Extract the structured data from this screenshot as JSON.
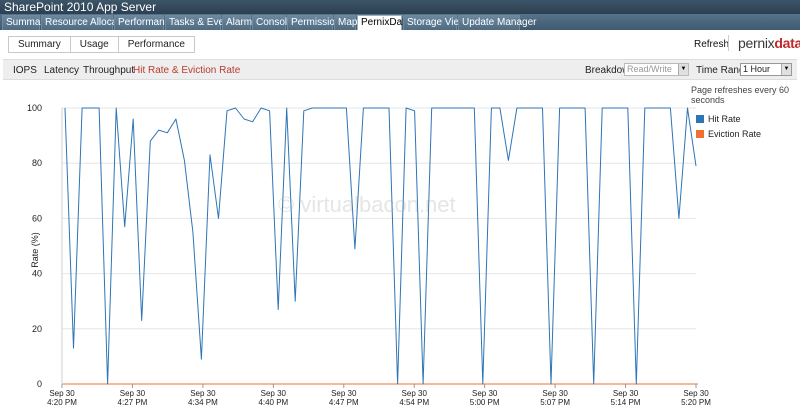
{
  "window": {
    "title": "SharePoint 2010 App Server"
  },
  "tabs": [
    {
      "label": "Summary"
    },
    {
      "label": "Resource Allocation"
    },
    {
      "label": "Performance"
    },
    {
      "label": "Tasks & Events"
    },
    {
      "label": "Alarms"
    },
    {
      "label": "Console"
    },
    {
      "label": "Permissions"
    },
    {
      "label": "Maps"
    },
    {
      "label": "PernixData"
    },
    {
      "label": "Storage Views"
    },
    {
      "label": "Update Manager"
    }
  ],
  "subtabs": [
    {
      "label": "Summary"
    },
    {
      "label": "Usage"
    },
    {
      "label": "Performance"
    }
  ],
  "header": {
    "refresh_label": "Refresh",
    "logo_part1": "pernix",
    "logo_part2": "data"
  },
  "metrics": [
    {
      "label": "IOPS"
    },
    {
      "label": "Latency"
    },
    {
      "label": "Throughput"
    },
    {
      "label": "Hit Rate & Eviction Rate"
    }
  ],
  "breakdown": {
    "label": "Breakdown:",
    "value": "Read/Write"
  },
  "time_range": {
    "label": "Time Range:",
    "value": "1 Hour"
  },
  "note": "Page refreshes every 60 seconds",
  "watermark": "© virtualbacon.net",
  "colors": {
    "hit": "#2e75b6",
    "eviction": "#f07030",
    "active_metric": "#b83a30"
  },
  "chart_data": {
    "type": "line",
    "ylabel": "Rate (%)",
    "ylim": [
      0,
      100
    ],
    "yticks": [
      0,
      20,
      40,
      60,
      80,
      100
    ],
    "x": [
      "4:20",
      "4:21",
      "4:22",
      "4:23",
      "4:24",
      "4:25",
      "4:26",
      "4:27",
      "4:28",
      "4:29",
      "4:30",
      "4:31",
      "4:32",
      "4:33",
      "4:34",
      "4:35",
      "4:36",
      "4:37",
      "4:38",
      "4:39",
      "4:40",
      "4:41",
      "4:42",
      "4:43",
      "4:44",
      "4:45",
      "4:46",
      "4:47",
      "4:48",
      "4:49",
      "4:50",
      "4:51",
      "4:52",
      "4:53",
      "4:54",
      "4:55",
      "4:56",
      "4:57",
      "4:58",
      "4:59",
      "5:00",
      "5:01",
      "5:02",
      "5:03",
      "5:04",
      "5:05",
      "5:06",
      "5:07",
      "5:08",
      "5:09",
      "5:10",
      "5:11",
      "5:12",
      "5:13",
      "5:14",
      "5:15",
      "5:16",
      "5:17",
      "5:18",
      "5:19",
      "5:20"
    ],
    "xticks": [
      {
        "date": "Sep 30",
        "time": "4:20 PM"
      },
      {
        "date": "Sep 30",
        "time": "4:27 PM"
      },
      {
        "date": "Sep 30",
        "time": "4:34 PM"
      },
      {
        "date": "Sep 30",
        "time": "4:40 PM"
      },
      {
        "date": "Sep 30",
        "time": "4:47 PM"
      },
      {
        "date": "Sep 30",
        "time": "4:54 PM"
      },
      {
        "date": "Sep 30",
        "time": "5:00 PM"
      },
      {
        "date": "Sep 30",
        "time": "5:07 PM"
      },
      {
        "date": "Sep 30",
        "time": "5:14 PM"
      },
      {
        "date": "Sep 30",
        "time": "5:20 PM"
      }
    ],
    "series": [
      {
        "name": "Hit Rate",
        "values": [
          100,
          13,
          100,
          100,
          100,
          0,
          100,
          57,
          96,
          23,
          88,
          92,
          91,
          96,
          81,
          55,
          9,
          83,
          60,
          99,
          100,
          96,
          95,
          100,
          99,
          27,
          100,
          30,
          99,
          100,
          100,
          100,
          100,
          100,
          49,
          100,
          100,
          100,
          100,
          0,
          100,
          99,
          0,
          100,
          100,
          100,
          100,
          100,
          100,
          0,
          100,
          100,
          81,
          100,
          100,
          100,
          100,
          0,
          100,
          100,
          100,
          100,
          0,
          100,
          100,
          100,
          100,
          0,
          100,
          100,
          100,
          100,
          60,
          100,
          79
        ]
      },
      {
        "name": "Eviction Rate",
        "values": [
          0,
          0,
          0,
          0,
          0,
          0,
          0,
          0,
          0,
          0,
          0,
          0,
          0,
          0,
          0,
          0,
          0,
          0,
          0,
          0,
          0,
          0,
          0,
          0,
          0,
          0,
          0,
          0,
          0,
          0,
          0,
          0,
          0,
          0,
          0,
          0,
          0,
          0,
          0,
          0,
          0,
          0,
          0,
          0,
          0,
          0,
          0,
          0,
          0,
          0,
          0,
          0,
          0,
          0,
          0,
          0,
          0,
          0,
          0,
          0,
          0,
          0,
          0,
          0,
          0,
          0,
          0,
          0,
          0,
          0,
          0,
          0,
          0,
          0,
          0
        ]
      }
    ],
    "legend": "right",
    "grid": true
  }
}
